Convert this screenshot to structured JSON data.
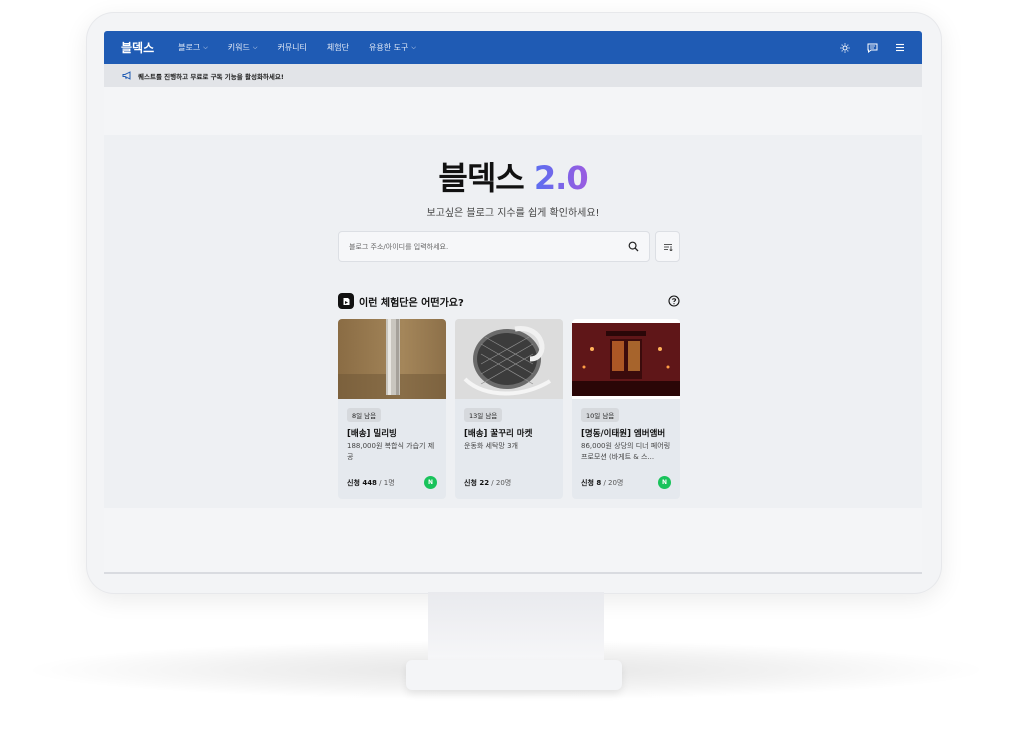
{
  "navbar": {
    "brand": "블덱스",
    "items": [
      {
        "label": "블로그",
        "has_dropdown": true
      },
      {
        "label": "키워드",
        "has_dropdown": true
      },
      {
        "label": "커뮤니티",
        "has_dropdown": false
      },
      {
        "label": "체험단",
        "has_dropdown": false
      },
      {
        "label": "유용한 도구",
        "has_dropdown": true
      }
    ],
    "right_icons": [
      "sun-icon",
      "chat-icon",
      "menu-icon"
    ],
    "bg_color": "#1f5bb4"
  },
  "notice": {
    "icon": "megaphone-icon",
    "text": "퀘스트를 진행하고 무료로 구독 기능을 활성화하세요!"
  },
  "hero": {
    "title": "블덱스",
    "version": "2.0",
    "subtitle": "보고싶은 블로그 지수를 쉽게 확인하세요!",
    "search_placeholder": "블로그 주소/아이디를 입력하세요."
  },
  "experience": {
    "title": "이런 체험단은 어떤가요?",
    "cards": [
      {
        "badge": "8일 남음",
        "title": "[배송] 밀리빙",
        "desc": "188,000원 복합식 가습기 제공",
        "applied": "신청 448",
        "total": "/ 1명",
        "platform": "N",
        "image": "humidifier-photo"
      },
      {
        "badge": "13일 남음",
        "title": "[배송] 꿀꾸리 마켓",
        "desc": "운동화 세탁망 3개",
        "applied": "신청 22",
        "total": "/ 20명",
        "platform": "",
        "image": "laundry-net-photo"
      },
      {
        "badge": "10일 남음",
        "title": "[명동/이태원] 엠버앰버",
        "desc": "86,000원 상당의 디너 페어링 프로모션 (바게트 & 스...",
        "applied": "신청 8",
        "total": "/ 20명",
        "platform": "N",
        "image": "restaurant-photo"
      }
    ]
  }
}
